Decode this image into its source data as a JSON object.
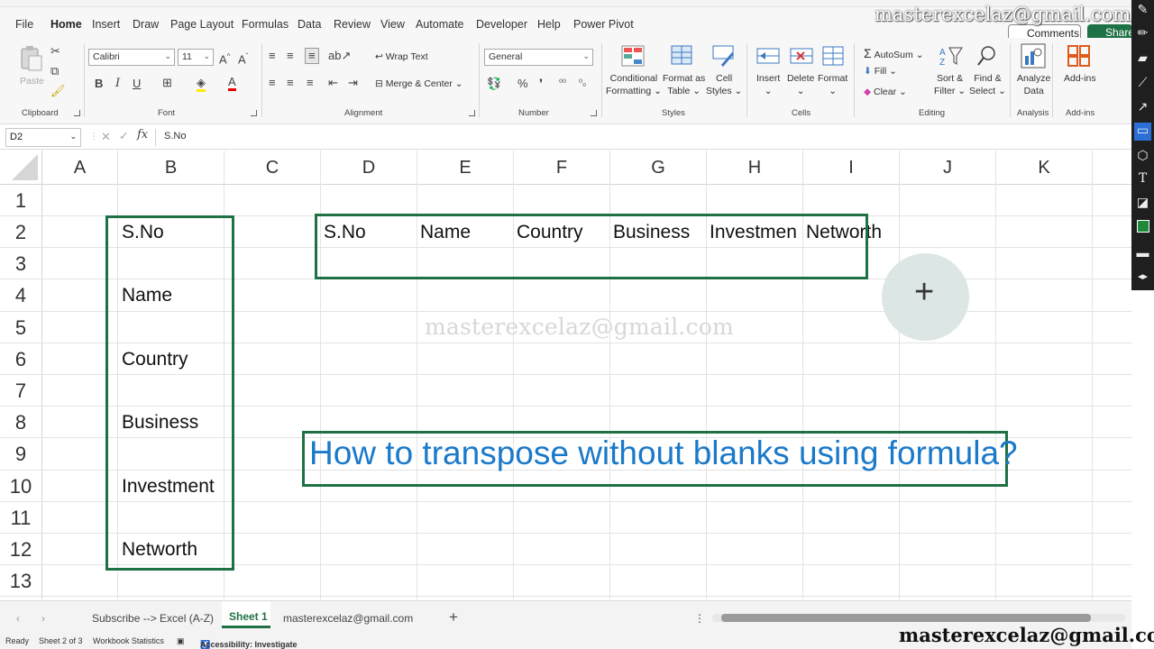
{
  "menu": {
    "tabs": [
      "File",
      "Home",
      "Insert",
      "Draw",
      "Page Layout",
      "Formulas",
      "Data",
      "Review",
      "View",
      "Automate",
      "Developer",
      "Help",
      "Power Pivot"
    ],
    "active": "Home",
    "comments": "Comments",
    "share": "Share"
  },
  "ribbon": {
    "clipboard": {
      "paste": "Paste",
      "label": "Clipboard"
    },
    "font": {
      "name": "Calibri",
      "size": "11",
      "label": "Font",
      "bold": "B",
      "italic": "I",
      "underline": "U",
      "grow": "A^",
      "shrink": "Aˇ"
    },
    "alignment": {
      "wrap": "Wrap Text",
      "merge": "Merge & Center",
      "label": "Alignment"
    },
    "number": {
      "format": "General",
      "label": "Number"
    },
    "styles": {
      "conditional": [
        "Conditional",
        "Formatting"
      ],
      "format_as_table": [
        "Format as",
        "Table"
      ],
      "cell_styles": [
        "Cell",
        "Styles"
      ],
      "label": "Styles"
    },
    "cells": {
      "insert": "Insert",
      "delete": "Delete",
      "format": "Format",
      "label": "Cells"
    },
    "editing": {
      "autosum": "AutoSum",
      "fill": "Fill",
      "clear": "Clear",
      "sort": [
        "Sort &",
        "Filter"
      ],
      "find": [
        "Find &",
        "Select"
      ],
      "label": "Editing"
    },
    "analysis": {
      "analyze": [
        "Analyze",
        "Data"
      ],
      "label": "Analysis"
    },
    "addins": {
      "addins": "Add-ins",
      "label": "Add-ins"
    }
  },
  "formula_bar": {
    "name_box": "D2",
    "fx": "fx",
    "value": "S.No"
  },
  "grid": {
    "columns": [
      "A",
      "B",
      "C",
      "D",
      "E",
      "F",
      "G",
      "H",
      "I",
      "J",
      "K"
    ],
    "rows": [
      "1",
      "2",
      "3",
      "4",
      "5",
      "6",
      "7",
      "8",
      "9",
      "10",
      "11",
      "12",
      "13"
    ],
    "column_b": [
      "S.No",
      "Name",
      "Country",
      "Business",
      "Investment",
      "Networth"
    ],
    "row_2": [
      "S.No",
      "Name",
      "Country",
      "Business",
      "Investmen",
      "Networth"
    ],
    "watermark": "masterexcelaz@gmail.com",
    "title": "How to transpose without blanks using formula?"
  },
  "sheet_tabs": {
    "tabs": [
      "Subscribe --> Excel (A-Z)",
      "Sheet 1",
      "masterexcelaz@gmail.com"
    ],
    "active": "Sheet 1",
    "add": "+"
  },
  "status": {
    "ready": "Ready",
    "sheet": "Sheet 2 of 3",
    "stats": "Workbook Statistics",
    "accessibility": "Accessibility: Investigate"
  },
  "overlay": {
    "top_watermark": "masterexcelaz@gmail.com",
    "bottom_watermark": "masterexcelaz@gmail.com"
  },
  "colors": {
    "accent": "#1e7145",
    "title_blue": "#1a79c9"
  }
}
